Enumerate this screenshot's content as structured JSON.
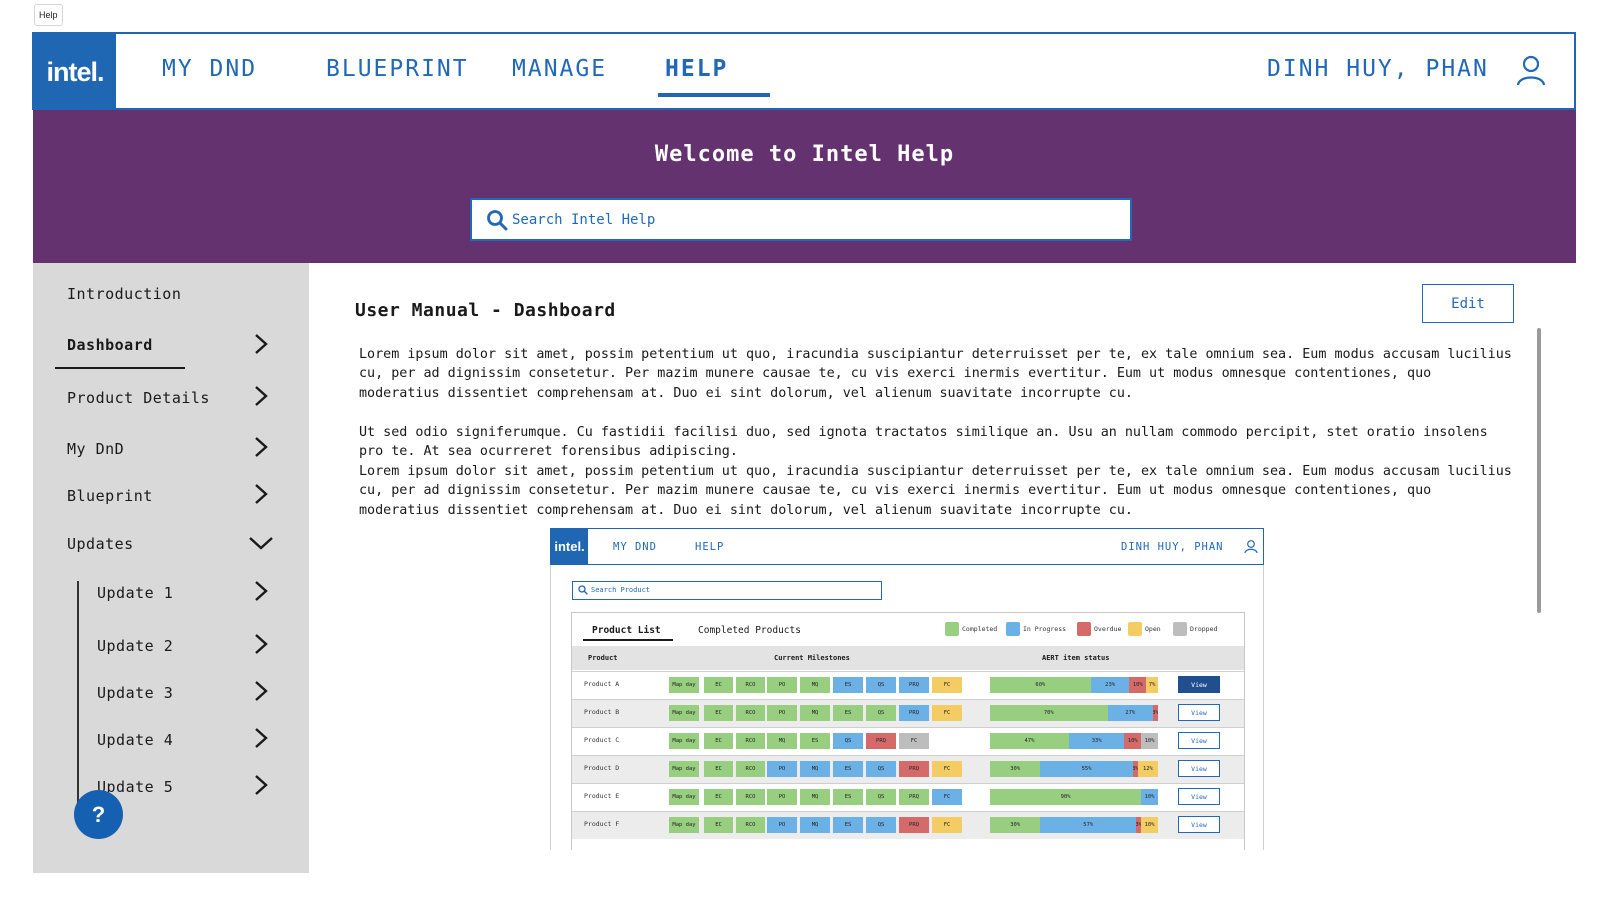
{
  "page_label": "Help",
  "colors": {
    "brand_blue": "#1f66b3",
    "banner_purple": "#653270",
    "sidebar_gray": "#d9d9d9",
    "completed": "#98ce7f",
    "in_progress": "#6cb1e6",
    "overdue": "#d46a6a",
    "open": "#f3cc63",
    "dropped": "#bdbdbd"
  },
  "nav": {
    "logo": "intel.",
    "links": [
      "MY DND",
      "BLUEPRINT",
      "MANAGE",
      "HELP"
    ],
    "active": "HELP",
    "user": "DINH HUY, PHAN",
    "user_icon": "user-icon"
  },
  "banner": {
    "title": "Welcome to Intel Help",
    "search_placeholder": "Search Intel Help",
    "search_icon": "search-icon"
  },
  "sidebar": {
    "items": [
      "Introduction",
      "Dashboard",
      "Product Details",
      "My DnD",
      "Blueprint",
      "Updates"
    ],
    "active": "Dashboard",
    "sub_items": [
      "Update 1",
      "Update 2",
      "Update 3",
      "Update 4",
      "Update 5"
    ],
    "help_button": "?"
  },
  "content": {
    "title": "User Manual - Dashboard",
    "edit_label": "Edit",
    "paragraphs": [
      "Lorem ipsum dolor sit amet, possim petentium ut quo, iracundia suscipiantur deterruisset per te, ex tale omnium sea. Eum modus accusam lucilius cu, per ad dignissim consetetur. Per mazim munere causae te, cu vis exerci inermis evertitur. Eum ut modus omnesque contentiones, quo moderatius dissentiet comprehensam at. Duo ei sint dolorum, vel alienum suavitate incorrupte cu.",
      "Ut sed odio signiferumque. Cu fastidii facilisi duo, sed ignota tractatos similique an. Usu an nullam commodo percipit, stet oratio insolens pro te. At sea ocurreret forensibus adipiscing.",
      "Lorem ipsum dolor sit amet, possim petentium ut quo, iracundia suscipiantur deterruisset per te, ex tale omnium sea. Eum modus accusam lucilius cu, per ad dignissim consetetur. Per mazim munere causae te, cu vis exerci inermis evertitur. Eum ut modus omnesque contentiones, quo moderatius dissentiet comprehensam at. Duo ei sint dolorum, vel alienum suavitate incorrupte cu."
    ]
  },
  "screenshot": {
    "logo": "intel.",
    "links": [
      "MY DND",
      "HELP"
    ],
    "user": "DINH HUY, PHAN",
    "search_placeholder": "Search Product",
    "tabs": [
      "Product List",
      "Completed Products"
    ],
    "legend": [
      {
        "label": "Completed",
        "color": "#98ce7f"
      },
      {
        "label": "In Progress",
        "color": "#6cb1e6"
      },
      {
        "label": "Overdue",
        "color": "#d46a6a"
      },
      {
        "label": "Open",
        "color": "#f3cc63"
      },
      {
        "label": "Dropped",
        "color": "#bdbdbd"
      }
    ],
    "columns": [
      "Product",
      "Current Milestones",
      "AERT item status"
    ],
    "view_label": "View",
    "rows": [
      {
        "name": "Product A",
        "milestones": [
          [
            "Map day",
            "C"
          ],
          [
            "EC",
            "C"
          ],
          [
            "RCO",
            "C"
          ],
          [
            "PO",
            "C"
          ],
          [
            "MQ",
            "C"
          ],
          [
            "ES",
            "P"
          ],
          [
            "QS",
            "P"
          ],
          [
            "PRQ",
            "P"
          ],
          [
            "FC",
            "O"
          ]
        ],
        "status": [
          [
            60,
            "60%",
            "C"
          ],
          [
            23,
            "23%",
            "P"
          ],
          [
            10,
            "10%",
            "D"
          ],
          [
            7,
            "7%",
            "O"
          ]
        ],
        "primary": true
      },
      {
        "name": "Product B",
        "milestones": [
          [
            "Map day",
            "C"
          ],
          [
            "EC",
            "C"
          ],
          [
            "RCO",
            "C"
          ],
          [
            "PO",
            "C"
          ],
          [
            "MQ",
            "C"
          ],
          [
            "ES",
            "C"
          ],
          [
            "QS",
            "C"
          ],
          [
            "PRQ",
            "P"
          ],
          [
            "FC",
            "O"
          ]
        ],
        "status": [
          [
            70,
            "70%",
            "C"
          ],
          [
            27,
            "27%",
            "P"
          ],
          [
            3,
            "3%",
            "D"
          ]
        ],
        "primary": false
      },
      {
        "name": "Product C",
        "milestones": [
          [
            "Map day",
            "C"
          ],
          [
            "EC",
            "C"
          ],
          [
            "RCO",
            "C"
          ],
          [
            "MQ",
            "C"
          ],
          [
            "ES",
            "C"
          ],
          [
            "QS",
            "P"
          ],
          [
            "PRQ",
            "D"
          ],
          [
            "FC",
            "X"
          ]
        ],
        "status": [
          [
            47,
            "47%",
            "C"
          ],
          [
            33,
            "33%",
            "P"
          ],
          [
            10,
            "10%",
            "D"
          ],
          [
            10,
            "10%",
            "X"
          ]
        ],
        "primary": false
      },
      {
        "name": "Product D",
        "milestones": [
          [
            "Map day",
            "C"
          ],
          [
            "EC",
            "C"
          ],
          [
            "RCO",
            "C"
          ],
          [
            "PO",
            "P"
          ],
          [
            "MQ",
            "P"
          ],
          [
            "ES",
            "P"
          ],
          [
            "QS",
            "P"
          ],
          [
            "PRQ",
            "D"
          ],
          [
            "FC",
            "O"
          ]
        ],
        "status": [
          [
            30,
            "30%",
            "C"
          ],
          [
            55,
            "55%",
            "P"
          ],
          [
            3,
            "3%",
            "D"
          ],
          [
            12,
            "12%",
            "O"
          ]
        ],
        "primary": false
      },
      {
        "name": "Product E",
        "milestones": [
          [
            "Map day",
            "C"
          ],
          [
            "EC",
            "C"
          ],
          [
            "RCO",
            "C"
          ],
          [
            "PO",
            "C"
          ],
          [
            "MQ",
            "C"
          ],
          [
            "ES",
            "C"
          ],
          [
            "QS",
            "C"
          ],
          [
            "PRQ",
            "C"
          ],
          [
            "FC",
            "P"
          ]
        ],
        "status": [
          [
            90,
            "90%",
            "C"
          ],
          [
            10,
            "10%",
            "P"
          ]
        ],
        "primary": false
      },
      {
        "name": "Product F",
        "milestones": [
          [
            "Map day",
            "C"
          ],
          [
            "EC",
            "C"
          ],
          [
            "RCO",
            "C"
          ],
          [
            "PO",
            "P"
          ],
          [
            "MQ",
            "P"
          ],
          [
            "ES",
            "P"
          ],
          [
            "QS",
            "P"
          ],
          [
            "PRQ",
            "D"
          ],
          [
            "FC",
            "O"
          ]
        ],
        "status": [
          [
            30,
            "30%",
            "C"
          ],
          [
            57,
            "57%",
            "P"
          ],
          [
            3,
            "3%",
            "D"
          ],
          [
            10,
            "10%",
            "O"
          ]
        ],
        "primary": false
      }
    ]
  }
}
